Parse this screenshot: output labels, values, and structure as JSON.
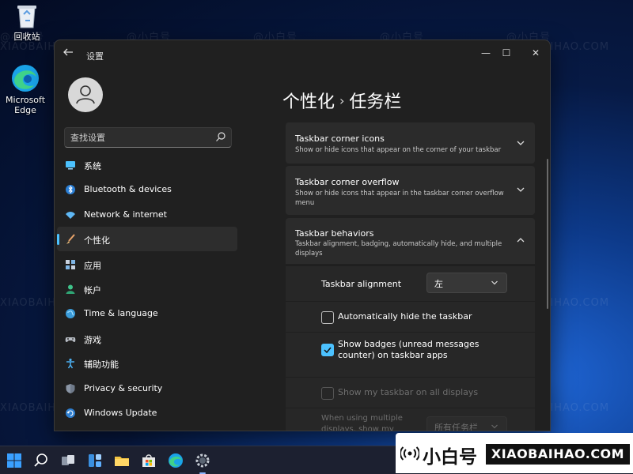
{
  "desktop": {
    "icons": [
      {
        "label": "回收站"
      },
      {
        "label": "Microsoft Edge"
      }
    ],
    "watermark_text": "@小白号",
    "watermark_domain": "XIAOBAIHAO.COM"
  },
  "window": {
    "title": "设置",
    "controls": {
      "minimize": "—",
      "maximize": "☐",
      "close": "✕"
    }
  },
  "sidebar": {
    "search_placeholder": "查找设置",
    "items": [
      {
        "label": "系统",
        "icon": "system-icon"
      },
      {
        "label": "Bluetooth & devices",
        "icon": "bluetooth-icon"
      },
      {
        "label": "Network & internet",
        "icon": "wifi-icon"
      },
      {
        "label": "个性化",
        "icon": "brush-icon",
        "active": true
      },
      {
        "label": "应用",
        "icon": "apps-icon"
      },
      {
        "label": "帐户",
        "icon": "account-icon"
      },
      {
        "label": "Time & language",
        "icon": "globe-icon"
      },
      {
        "label": "游戏",
        "icon": "gamepad-icon"
      },
      {
        "label": "辅助功能",
        "icon": "accessibility-icon"
      },
      {
        "label": "Privacy & security",
        "icon": "shield-icon"
      },
      {
        "label": "Windows Update",
        "icon": "update-icon"
      }
    ]
  },
  "main": {
    "breadcrumb": {
      "parent": "个性化",
      "separator": "›",
      "current": "任务栏"
    },
    "cards": [
      {
        "title": "Taskbar corner icons",
        "description": "Show or hide icons that appear on the corner of your taskbar",
        "expanded": false
      },
      {
        "title": "Taskbar corner overflow",
        "description": "Show or hide icons that appear in the taskbar corner overflow menu",
        "expanded": false
      },
      {
        "title": "Taskbar behaviors",
        "description": "Taskbar alignment, badging, automatically hide, and multiple displays",
        "expanded": true
      }
    ],
    "behaviors": {
      "alignment_label": "Taskbar alignment",
      "alignment_value": "左",
      "autohide_label": "Automatically hide the taskbar",
      "autohide_checked": false,
      "badges_label": "Show badges (unread messages counter) on taskbar apps",
      "badges_checked": true,
      "mytaskbar_label": "Show my taskbar on all displays",
      "mytaskbar_checked": false,
      "multi_label": "When using multiple displays, show my",
      "multi_value": "所有任务栏"
    }
  },
  "taskbar": {
    "icons": [
      "start-icon",
      "search-icon",
      "task-view-icon",
      "widgets-icon",
      "file-explorer-icon",
      "store-icon",
      "edge-icon",
      "settings-icon"
    ],
    "active": "settings-icon"
  },
  "brand": {
    "name": "小白号",
    "domain": "XIAOBAIHAO.COM"
  },
  "colors": {
    "accent": "#4cc2ff",
    "window_bg": "#202020",
    "card_bg": "#2b2b2b"
  }
}
